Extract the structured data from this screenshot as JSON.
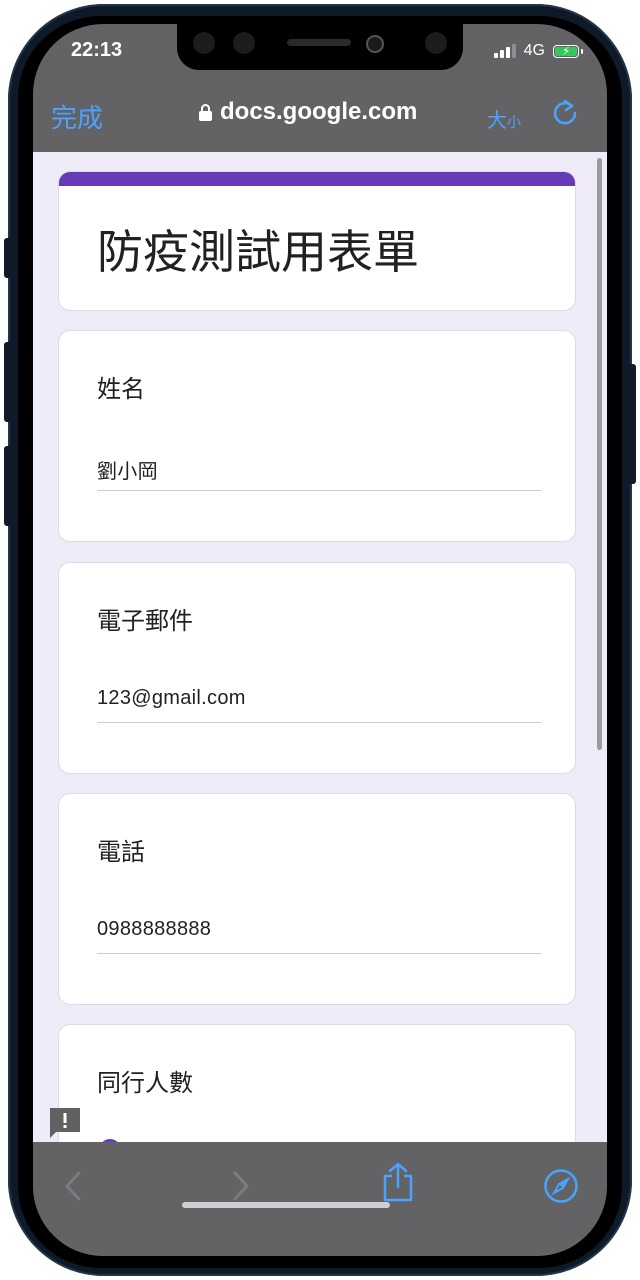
{
  "status_bar": {
    "time": "22:13",
    "network": "4G"
  },
  "safari_header": {
    "done_label": "完成",
    "url": "docs.google.com",
    "text_size_big": "大",
    "text_size_small": "小"
  },
  "form": {
    "title": "防疫測試用表單",
    "questions": [
      {
        "label": "姓名",
        "answer": "劉小岡"
      },
      {
        "label": "電子郵件",
        "answer": "123@gmail.com"
      },
      {
        "label": "電話",
        "answer": "0988888888"
      },
      {
        "label": "同行人數"
      }
    ]
  },
  "colors": {
    "accent": "#673ab7",
    "link_blue": "#4aa3ff",
    "content_bg": "#efebf8",
    "battery_green": "#34c759"
  },
  "icons": [
    "lock-icon",
    "reload-icon",
    "feedback-icon",
    "back-icon",
    "forward-icon",
    "share-icon",
    "compass-icon"
  ]
}
